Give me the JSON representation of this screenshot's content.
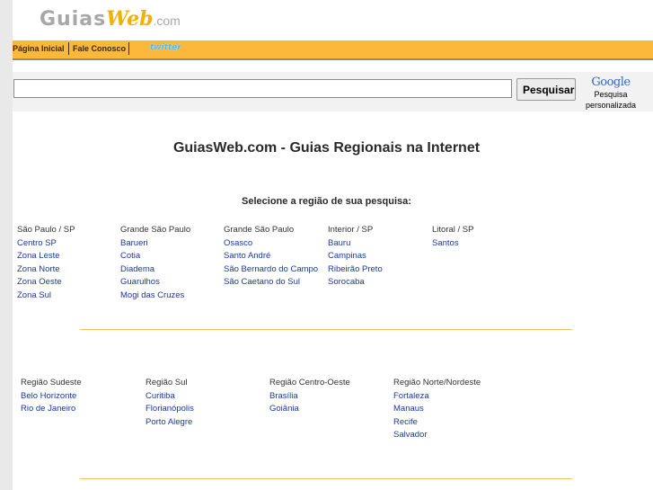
{
  "logo": {
    "guias": "Guias",
    "web": "Web",
    "com": ".com"
  },
  "nav": {
    "home": "Página Inicial",
    "contact": "Fale Conosco",
    "twitter": "twitter"
  },
  "search": {
    "value": "",
    "button": "Pesquisar",
    "google_logo": "Google",
    "google_caption_1": "Pesquisa",
    "google_caption_2": "personalizada"
  },
  "headline": "GuiasWeb.com - Guias Regionais na Internet",
  "instruction": "Selecione a região de sua pesquisa:",
  "sections": [
    {
      "columns": [
        {
          "heading": "São Paulo / SP",
          "links": [
            "Centro SP",
            "Zona Leste",
            "Zona Norte",
            "Zona Oeste",
            "Zona Sul"
          ]
        },
        {
          "heading": "Grande São Paulo",
          "links": [
            "Barueri",
            "Cotia",
            "Diadema",
            "Guarulhos",
            "Mogi das Cruzes"
          ]
        },
        {
          "heading": "Grande São Paulo",
          "links": [
            "Osasco",
            "Santo André",
            "São Bernardo do Campo",
            "São Caetano do Sul"
          ]
        },
        {
          "heading": "Interior / SP",
          "links": [
            "Bauru",
            "Campinas",
            "Ribeirão Preto",
            "Sorocaba"
          ]
        },
        {
          "heading": "Litoral / SP",
          "links": [
            "Santos"
          ]
        }
      ]
    },
    {
      "columns": [
        {
          "heading": "Região Sudeste",
          "links": [
            "Belo Horizonte",
            "Rio de Janeiro"
          ]
        },
        {
          "heading": "Região Sul",
          "links": [
            "Curitiba",
            "Florianópolis",
            "Porto Alegre"
          ]
        },
        {
          "heading": "Região Centro-Oeste",
          "links": [
            "Brasília",
            "Goiânia"
          ]
        },
        {
          "heading": "Região Norte/Nordeste",
          "links": [
            "Fortaleza",
            "Manaus",
            "Recife",
            "Salvador"
          ]
        }
      ]
    }
  ]
}
